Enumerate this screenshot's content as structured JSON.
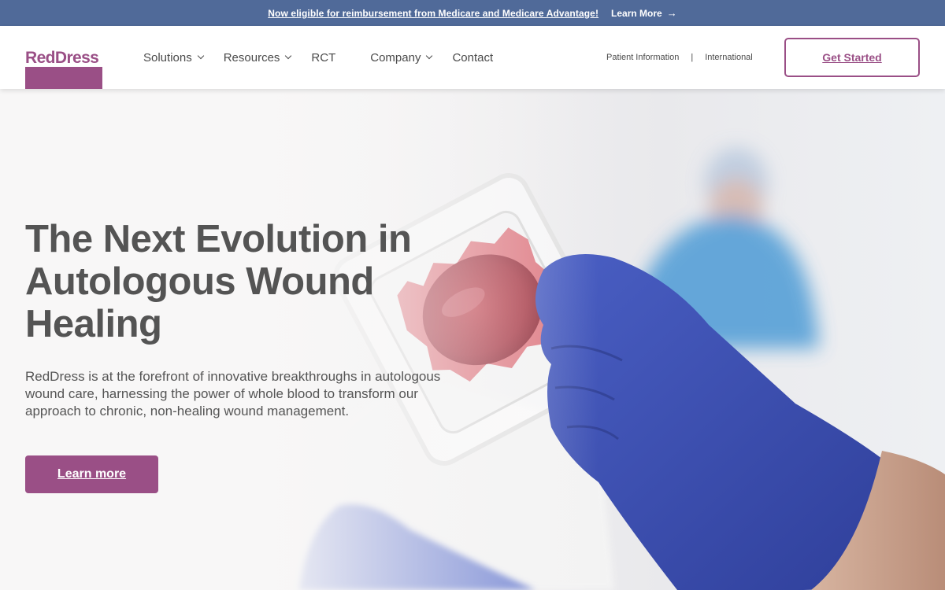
{
  "announcement": {
    "message": "Now eligible for reimbursement from Medicare and Medicare Advantage!",
    "link_label": "Learn More",
    "link_icon": "arrow-right-icon"
  },
  "header": {
    "logo_text": "RedDress",
    "nav": [
      {
        "label": "Solutions",
        "has_dropdown": true
      },
      {
        "label": "Resources",
        "has_dropdown": true
      },
      {
        "label": "RCT",
        "has_dropdown": false
      },
      {
        "label": "Company",
        "has_dropdown": true
      },
      {
        "label": "Contact",
        "has_dropdown": false
      }
    ],
    "utility": {
      "patient_info": "Patient Information",
      "separator": "|",
      "international": "International"
    },
    "cta_label": "Get Started"
  },
  "hero": {
    "title": "The Next Evolution in Autologous Wound Healing",
    "lead": "RedDress is at the forefront of innovative breakthroughs in autologous wound care, harnessing the power of whole blood to transform our approach to chronic, non-healing wound management.",
    "button_label": "Learn more",
    "image_subject": "gloved-hand-holding-blood-clot-dressing"
  },
  "colors": {
    "brand": "#9a4f86",
    "announcement_bg": "#506a99",
    "heading": "#545454",
    "glove": "#3d52b5"
  }
}
